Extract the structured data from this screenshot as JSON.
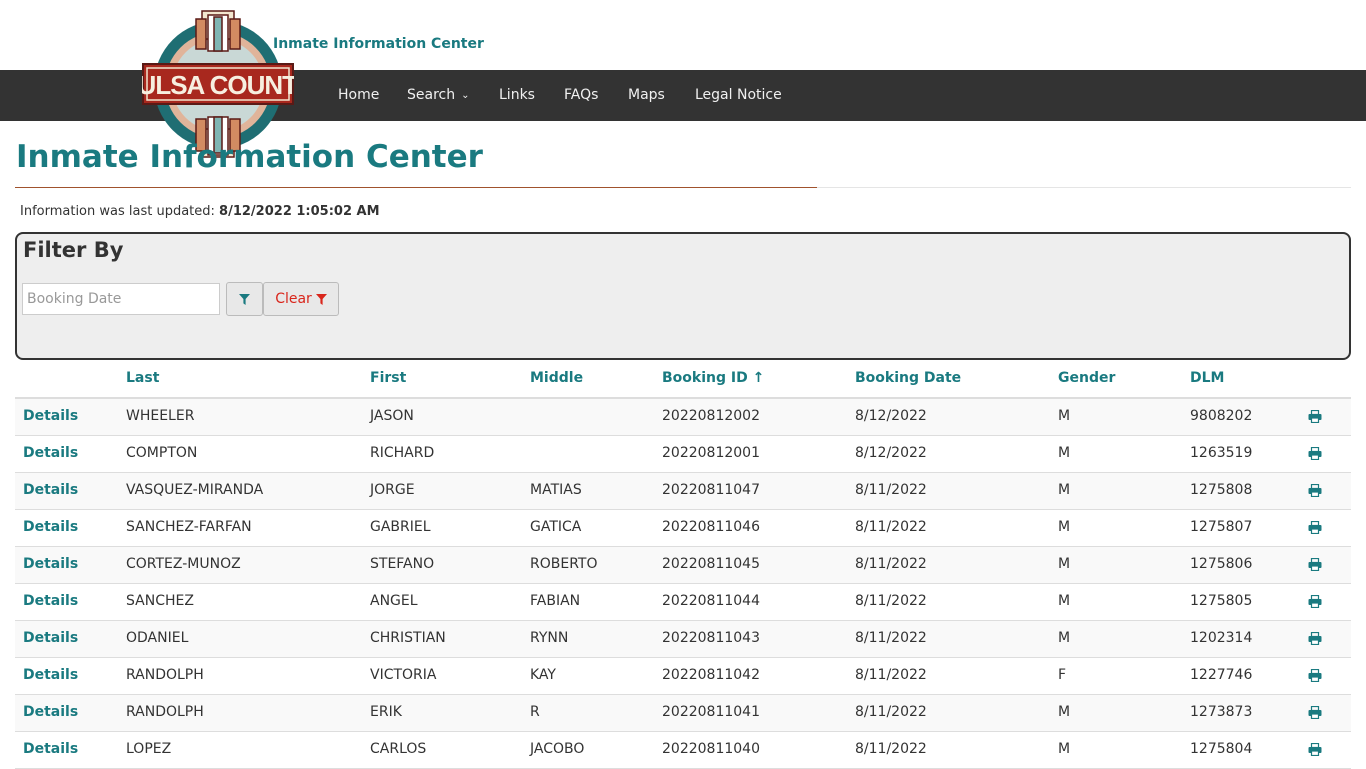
{
  "header": {
    "site_title": "Inmate Information Center",
    "logo_text": "TULSA COUNTY"
  },
  "nav": {
    "items": [
      {
        "label": "Home"
      },
      {
        "label": "Search",
        "has_dropdown": true
      },
      {
        "label": "Links"
      },
      {
        "label": "FAQs"
      },
      {
        "label": "Maps"
      },
      {
        "label": "Legal Notice"
      }
    ]
  },
  "page": {
    "title": "Inmate Information Center",
    "updated_label": "Information was last updated:",
    "updated_value": "8/12/2022 1:05:02 AM"
  },
  "filter": {
    "title": "Filter By",
    "date_placeholder": "Booking Date",
    "date_value": "",
    "clear_label": "Clear"
  },
  "table": {
    "columns": [
      "Last",
      "First",
      "Middle",
      "Booking ID ↑",
      "Booking Date",
      "Gender",
      "DLM"
    ],
    "details_label": "Details",
    "rows": [
      {
        "last": "WHEELER",
        "first": "JASON",
        "middle": "",
        "booking_id": "20220812002",
        "booking_date": "8/12/2022",
        "gender": "M",
        "dlm": "9808202"
      },
      {
        "last": "COMPTON",
        "first": "RICHARD",
        "middle": "",
        "booking_id": "20220812001",
        "booking_date": "8/12/2022",
        "gender": "M",
        "dlm": "1263519"
      },
      {
        "last": "VASQUEZ-MIRANDA",
        "first": "JORGE",
        "middle": "MATIAS",
        "booking_id": "20220811047",
        "booking_date": "8/11/2022",
        "gender": "M",
        "dlm": "1275808"
      },
      {
        "last": "SANCHEZ-FARFAN",
        "first": "GABRIEL",
        "middle": "GATICA",
        "booking_id": "20220811046",
        "booking_date": "8/11/2022",
        "gender": "M",
        "dlm": "1275807"
      },
      {
        "last": "CORTEZ-MUNOZ",
        "first": "STEFANO",
        "middle": "ROBERTO",
        "booking_id": "20220811045",
        "booking_date": "8/11/2022",
        "gender": "M",
        "dlm": "1275806"
      },
      {
        "last": "SANCHEZ",
        "first": "ANGEL",
        "middle": "FABIAN",
        "booking_id": "20220811044",
        "booking_date": "8/11/2022",
        "gender": "M",
        "dlm": "1275805"
      },
      {
        "last": "ODANIEL",
        "first": "CHRISTIAN",
        "middle": "RYNN",
        "booking_id": "20220811043",
        "booking_date": "8/11/2022",
        "gender": "M",
        "dlm": "1202314"
      },
      {
        "last": "RANDOLPH",
        "first": "VICTORIA",
        "middle": "KAY",
        "booking_id": "20220811042",
        "booking_date": "8/11/2022",
        "gender": "F",
        "dlm": "1227746"
      },
      {
        "last": "RANDOLPH",
        "first": "ERIK",
        "middle": "R",
        "booking_id": "20220811041",
        "booking_date": "8/11/2022",
        "gender": "M",
        "dlm": "1273873"
      },
      {
        "last": "LOPEZ",
        "first": "CARLOS",
        "middle": "JACOBO",
        "booking_id": "20220811040",
        "booking_date": "8/11/2022",
        "gender": "M",
        "dlm": "1275804"
      }
    ]
  },
  "colors": {
    "accent": "#1a7a80",
    "navbar": "#333333",
    "clear": "#d9261c",
    "rule": "#a0522d"
  },
  "icons": {
    "filter": "filter-icon",
    "print": "print-icon",
    "dropdown": "chevron-down-icon"
  }
}
